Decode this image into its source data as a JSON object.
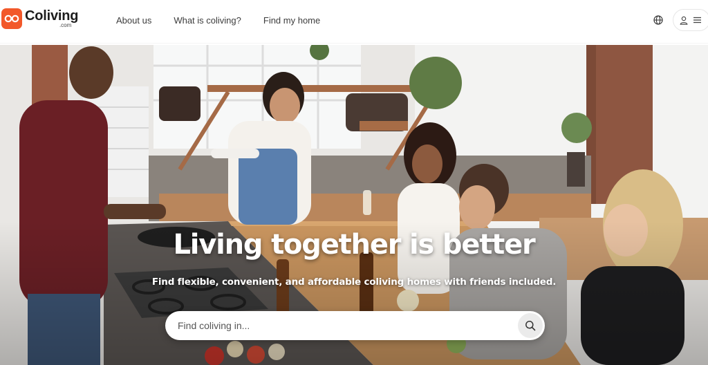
{
  "brand": {
    "name": "Coliving",
    "suffix": ".com",
    "accent_color": "#f2582a"
  },
  "nav": {
    "items": [
      {
        "label": "About us"
      },
      {
        "label": "What is coliving?"
      },
      {
        "label": "Find my home"
      }
    ]
  },
  "header_actions": {
    "language_icon": "globe-icon",
    "account_icons": [
      "user-icon",
      "menu-icon"
    ]
  },
  "hero": {
    "title": "Living together is better",
    "subtitle": "Find flexible, convenient, and affordable coliving homes with friends included.",
    "search": {
      "placeholder": "Find coliving in...",
      "value": "",
      "button_icon": "search-icon"
    }
  }
}
